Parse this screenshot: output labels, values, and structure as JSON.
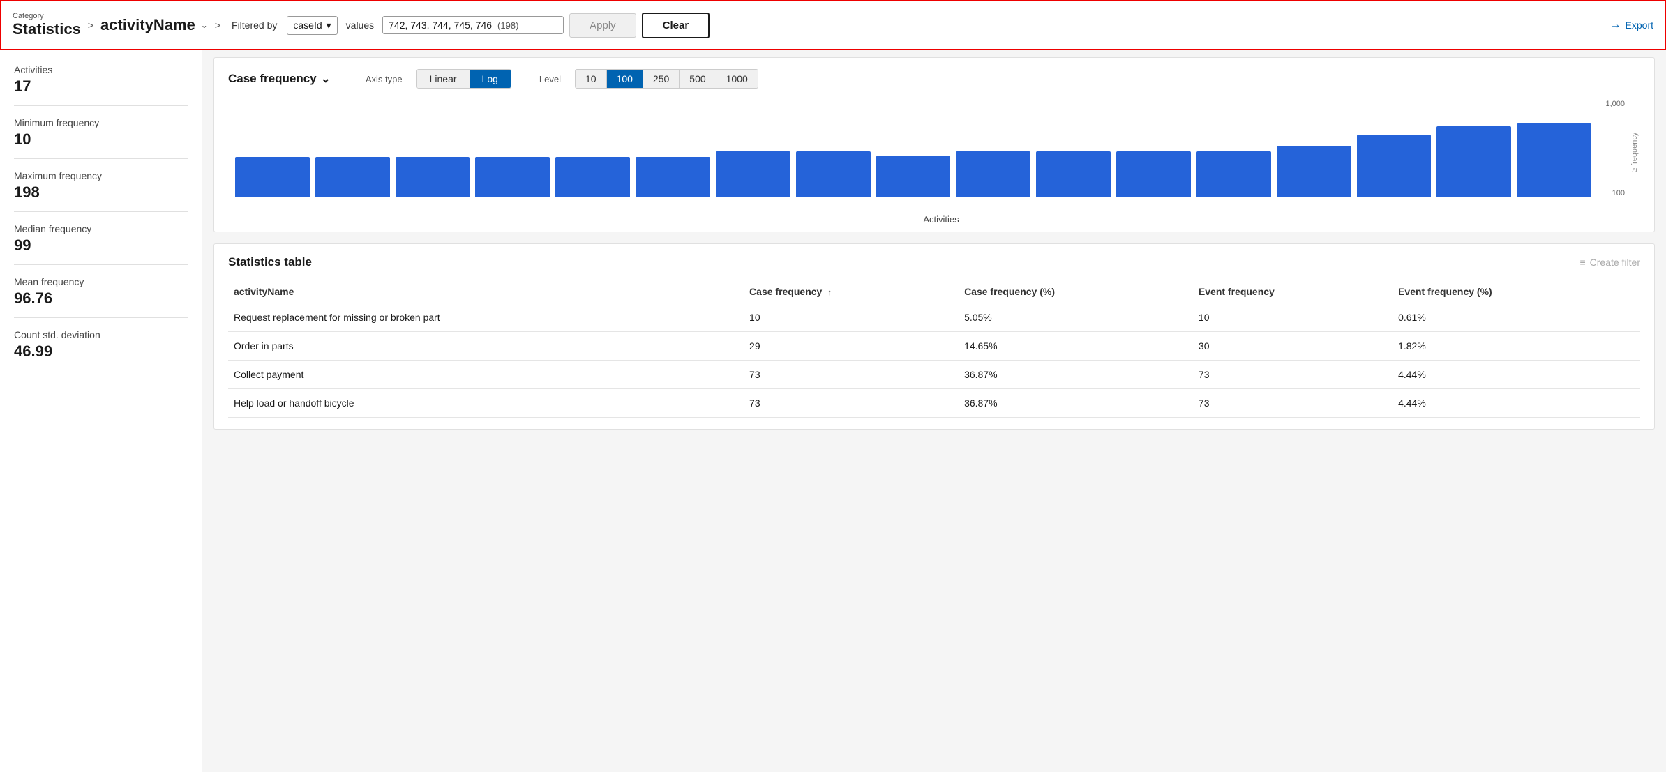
{
  "header": {
    "category_label": "Category",
    "title": "Statistics",
    "breadcrumb_arrow1": ">",
    "activity_name": "activityName",
    "chevron": "⌄",
    "breadcrumb_arrow2": ">",
    "filtered_by": "Filtered by",
    "filter_field": "caseId",
    "values_label": "values",
    "filter_values": "742, 743, 744, 745, 746",
    "filter_count": "(198)",
    "apply_label": "Apply",
    "clear_label": "Clear",
    "export_label": "Export",
    "export_arrow": "→"
  },
  "sidebar": {
    "items": [
      {
        "label": "Activities",
        "value": "17"
      },
      {
        "label": "Minimum frequency",
        "value": "10"
      },
      {
        "label": "Maximum frequency",
        "value": "198"
      },
      {
        "label": "Median frequency",
        "value": "99"
      },
      {
        "label": "Mean frequency",
        "value": "96.76"
      },
      {
        "label": "Count std. deviation",
        "value": "46.99"
      }
    ]
  },
  "chart": {
    "title": "Case frequency",
    "chevron": "⌄",
    "axis_type_label": "Axis type",
    "axis_buttons": [
      {
        "label": "Linear",
        "active": false
      },
      {
        "label": "Log",
        "active": true
      }
    ],
    "level_label": "Level",
    "level_buttons": [
      {
        "label": "10",
        "active": false
      },
      {
        "label": "100",
        "active": true
      },
      {
        "label": "250",
        "active": false
      },
      {
        "label": "500",
        "active": false
      },
      {
        "label": "1000",
        "active": false
      }
    ],
    "y_axis_labels": [
      "1,000",
      "100"
    ],
    "y_axis_title": "≥ frequency",
    "x_axis_label": "Activities",
    "bars": [
      {
        "height_pct": 48
      },
      {
        "height_pct": 48
      },
      {
        "height_pct": 48
      },
      {
        "height_pct": 48
      },
      {
        "height_pct": 48
      },
      {
        "height_pct": 48
      },
      {
        "height_pct": 55
      },
      {
        "height_pct": 55
      },
      {
        "height_pct": 50
      },
      {
        "height_pct": 55
      },
      {
        "height_pct": 55
      },
      {
        "height_pct": 55
      },
      {
        "height_pct": 55
      },
      {
        "height_pct": 62
      },
      {
        "height_pct": 75
      },
      {
        "height_pct": 85
      },
      {
        "height_pct": 88
      }
    ]
  },
  "statistics_table": {
    "title": "Statistics table",
    "create_filter_label": "Create filter",
    "columns": [
      {
        "label": "activityName",
        "sort": ""
      },
      {
        "label": "Case frequency",
        "sort": "↑"
      },
      {
        "label": "Case frequency (%)",
        "sort": ""
      },
      {
        "label": "Event frequency",
        "sort": ""
      },
      {
        "label": "Event frequency (%)",
        "sort": ""
      }
    ],
    "rows": [
      {
        "activity": "Request replacement for missing or broken part",
        "case_freq": "10",
        "case_freq_pct": "5.05%",
        "event_freq": "10",
        "event_freq_pct": "0.61%"
      },
      {
        "activity": "Order in parts",
        "case_freq": "29",
        "case_freq_pct": "14.65%",
        "event_freq": "30",
        "event_freq_pct": "1.82%"
      },
      {
        "activity": "Collect payment",
        "case_freq": "73",
        "case_freq_pct": "36.87%",
        "event_freq": "73",
        "event_freq_pct": "4.44%"
      },
      {
        "activity": "Help load or handoff bicycle",
        "case_freq": "73",
        "case_freq_pct": "36.87%",
        "event_freq": "73",
        "event_freq_pct": "4.44%"
      }
    ]
  }
}
